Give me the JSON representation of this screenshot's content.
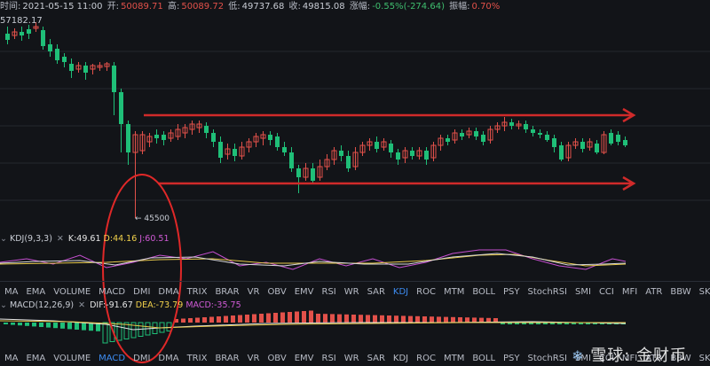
{
  "header": {
    "time_label": "时间:",
    "time_value": "2021-05-15 11:00",
    "open_label": "开:",
    "open_value": "50089.71",
    "high_label": "高:",
    "high_value": "50089.72",
    "low_label": "低:",
    "low_value": "49737.68",
    "close_label": "收:",
    "close_value": "49815.08",
    "change_label": "涨幅:",
    "change_value": "-0.55%(-274.64)",
    "amp_label": "振幅:",
    "amp_value": "0.70%"
  },
  "chart": {
    "high_label": "57182.17",
    "low_label": "← 45500"
  },
  "kdj": {
    "name": "KDJ(9,3,3)",
    "k": "K:49.61",
    "d": "D:44.16",
    "j": "J:60.51"
  },
  "macd": {
    "name": "MACD(12,26,9)",
    "dif": "DIF:-91.67",
    "dea": "DEA:-73.79",
    "macd": "MACD:-35.75"
  },
  "tabs": [
    "MA",
    "EMA",
    "VOLUME",
    "MACD",
    "DMI",
    "DMA",
    "TRIX",
    "BRAR",
    "VR",
    "OBV",
    "EMV",
    "RSI",
    "WR",
    "SAR",
    "KDJ",
    "ROC",
    "MTM",
    "BOLL",
    "PSY",
    "StochRSI",
    "SMI",
    "CCI",
    "MFI",
    "ATR",
    "BBW",
    "SKDJ"
  ],
  "tabs_row1_active": "KDJ",
  "tabs_row2_active": "MACD",
  "watermark": "雪球: 金财币",
  "colors": {
    "up": "#e2514a",
    "down": "#1fbf78",
    "arrow": "#d02a2a",
    "ellipse": "#e02828",
    "active_tab": "#3d8cf2"
  }
}
